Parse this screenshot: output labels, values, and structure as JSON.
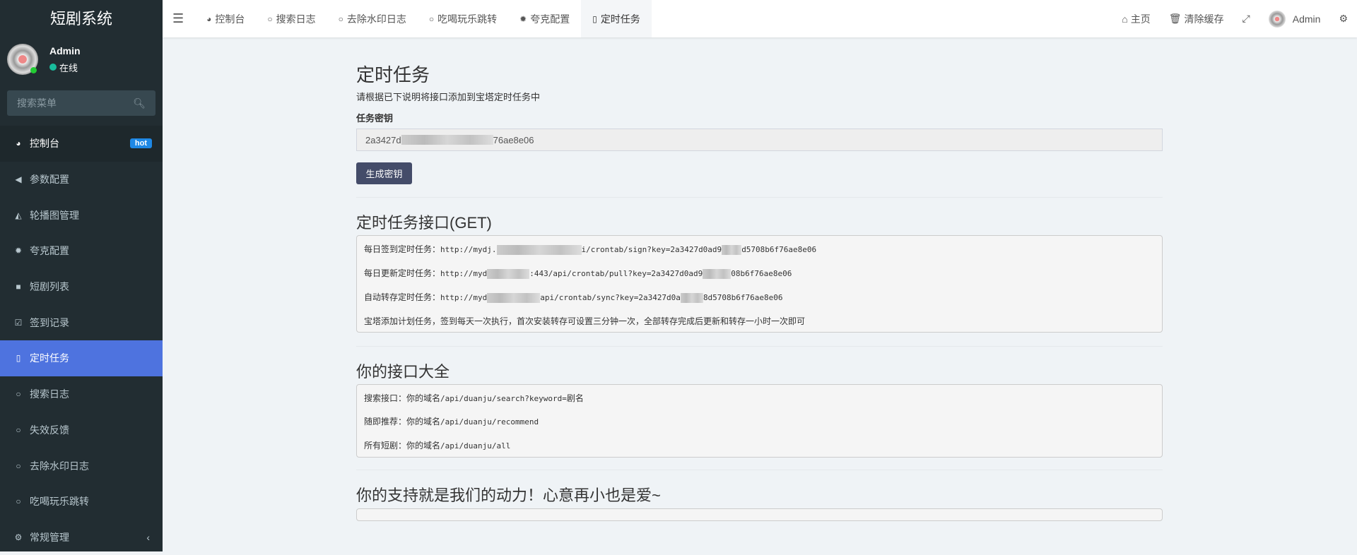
{
  "sidebar": {
    "title": "短剧系统",
    "user": {
      "name": "Admin",
      "status": "在线"
    },
    "search_placeholder": "搜索菜单",
    "items": [
      {
        "label": "控制台",
        "badge": "hot"
      },
      {
        "label": "参数配置"
      },
      {
        "label": "轮播图管理"
      },
      {
        "label": "夸克配置"
      },
      {
        "label": "短剧列表"
      },
      {
        "label": "签到记录"
      },
      {
        "label": "定时任务"
      },
      {
        "label": "搜索日志"
      },
      {
        "label": "失效反馈"
      },
      {
        "label": "去除水印日志"
      },
      {
        "label": "吃喝玩乐跳转"
      },
      {
        "label": "常规管理"
      }
    ]
  },
  "header": {
    "tabs": [
      "控制台",
      "搜索日志",
      "去除水印日志",
      "吃喝玩乐跳转",
      "夸克配置",
      "定时任务"
    ],
    "home": "主页",
    "clear_cache": "清除缓存",
    "user": "Admin"
  },
  "main": {
    "title": "定时任务",
    "subtitle": "请根据已下说明将接口添加到宝塔定时任务中",
    "key_label": "任务密钥",
    "key_prefix": "2a3427d",
    "key_suffix": "76ae8e06",
    "generate_btn": "生成密钥",
    "cron_title": "定时任务接口(GET)",
    "cron": [
      {
        "label": "每日签到定时任务：",
        "a": "http://mydj.",
        "b": "i/crontab/sign?key=2a3427d0ad9",
        "c": "d5708b6f76ae8e06"
      },
      {
        "label": "每日更新定时任务：",
        "a": "http://myd",
        "b": ":443/api/crontab/pull?key=2a3427d0ad9",
        "c": "08b6f76ae8e06"
      },
      {
        "label": "自动转存定时任务：",
        "a": "http://myd",
        "b": "api/crontab/sync?key=2a3427d0a",
        "c": "8d5708b6f76ae8e06"
      }
    ],
    "cron_note": "宝塔添加计划任务，签到每天一次执行，首次安装转存可设置三分钟一次，全部转存完成后更新和转存一小时一次即可",
    "api_title": "你的接口大全",
    "apis": [
      {
        "label": "搜索接口：你的域名",
        "path": "/api/duanju/search?keyword=",
        "tail": "剧名"
      },
      {
        "label": "随即推荐：你的域名",
        "path": "/api/duanju/recommend",
        "tail": ""
      },
      {
        "label": "所有短剧：你的域名",
        "path": "/api/duanju/all",
        "tail": ""
      }
    ],
    "support_title": "你的支持就是我们的动力！心意再小也是爱~"
  }
}
